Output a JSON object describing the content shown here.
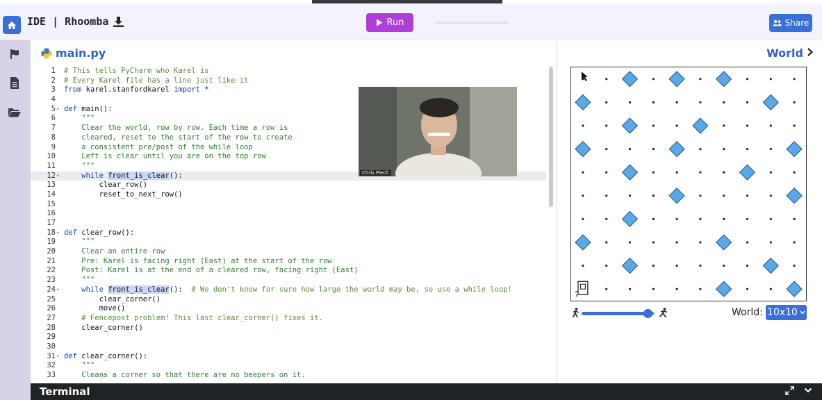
{
  "topbar": {
    "app_title": "IDE | Rhoomba",
    "run_label": "Run",
    "share_label": "Share"
  },
  "editor": {
    "file_name": "main.py",
    "lines": [
      {
        "n": "1",
        "fold": "",
        "active": false,
        "parts": [
          {
            "c": "cm",
            "t": "# This tells PyCharm who Karel is"
          }
        ]
      },
      {
        "n": "2",
        "fold": "",
        "active": false,
        "parts": [
          {
            "c": "cm",
            "t": "# Every Karel file has a line just like it"
          }
        ]
      },
      {
        "n": "3",
        "fold": "",
        "active": false,
        "parts": [
          {
            "c": "kw",
            "t": "from"
          },
          {
            "c": "fn",
            "t": " karel.stanfordkarel "
          },
          {
            "c": "kw",
            "t": "import"
          },
          {
            "c": "fn",
            "t": " *"
          }
        ]
      },
      {
        "n": "4",
        "fold": "",
        "active": false,
        "parts": []
      },
      {
        "n": "5",
        "fold": "▾",
        "active": false,
        "parts": [
          {
            "c": "kw",
            "t": "def"
          },
          {
            "c": "fn",
            "t": " main():"
          }
        ]
      },
      {
        "n": "6",
        "fold": "",
        "active": false,
        "parts": [
          {
            "c": "st",
            "t": "    \"\"\""
          }
        ]
      },
      {
        "n": "7",
        "fold": "",
        "active": false,
        "parts": [
          {
            "c": "st",
            "t": "    Clear the world, row by row. Each time a row is"
          }
        ]
      },
      {
        "n": "8",
        "fold": "",
        "active": false,
        "parts": [
          {
            "c": "st",
            "t": "    cleared, reset to the start of the row to create"
          }
        ]
      },
      {
        "n": "9",
        "fold": "",
        "active": false,
        "parts": [
          {
            "c": "st",
            "t": "    a consistent pre/post of the while loop"
          }
        ]
      },
      {
        "n": "10",
        "fold": "",
        "active": false,
        "parts": [
          {
            "c": "st",
            "t": "    Left is clear until you are on the top row"
          }
        ]
      },
      {
        "n": "11",
        "fold": "",
        "active": false,
        "parts": [
          {
            "c": "st",
            "t": "    \"\"\""
          }
        ]
      },
      {
        "n": "12",
        "fold": "▾",
        "active": true,
        "parts": [
          {
            "c": "kw",
            "t": "    while"
          },
          {
            "c": "fn",
            "t": " "
          },
          {
            "c": "fn hl",
            "t": "front_is_clear"
          },
          {
            "c": "fn",
            "t": "():"
          }
        ]
      },
      {
        "n": "13",
        "fold": "",
        "active": false,
        "parts": [
          {
            "c": "fn",
            "t": "        clear_row()"
          }
        ]
      },
      {
        "n": "14",
        "fold": "",
        "active": false,
        "parts": [
          {
            "c": "fn",
            "t": "        reset_to_next_row()"
          }
        ]
      },
      {
        "n": "15",
        "fold": "",
        "active": false,
        "parts": []
      },
      {
        "n": "16",
        "fold": "",
        "active": false,
        "parts": []
      },
      {
        "n": "17",
        "fold": "",
        "active": false,
        "parts": []
      },
      {
        "n": "18",
        "fold": "▾",
        "active": false,
        "parts": [
          {
            "c": "kw",
            "t": "def"
          },
          {
            "c": "fn",
            "t": " clear_row():"
          }
        ]
      },
      {
        "n": "19",
        "fold": "",
        "active": false,
        "parts": [
          {
            "c": "st",
            "t": "    \"\"\""
          }
        ]
      },
      {
        "n": "20",
        "fold": "",
        "active": false,
        "parts": [
          {
            "c": "st",
            "t": "    Clear an entire row"
          }
        ]
      },
      {
        "n": "21",
        "fold": "",
        "active": false,
        "parts": [
          {
            "c": "st",
            "t": "    Pre: Karel is facing right (East) at the start of the row"
          }
        ]
      },
      {
        "n": "22",
        "fold": "",
        "active": false,
        "parts": [
          {
            "c": "st",
            "t": "    Post: Karel is at the end of a cleared row, facing right (East)"
          }
        ]
      },
      {
        "n": "23",
        "fold": "",
        "active": false,
        "parts": [
          {
            "c": "st",
            "t": "    \"\"\""
          }
        ]
      },
      {
        "n": "24",
        "fold": "▾",
        "active": false,
        "parts": [
          {
            "c": "kw",
            "t": "    while"
          },
          {
            "c": "fn",
            "t": " "
          },
          {
            "c": "fn hl",
            "t": "front_is_clear"
          },
          {
            "c": "fn",
            "t": "():  "
          },
          {
            "c": "cm",
            "t": "# We don't know for sure how large the world may be, so use a while loop!"
          }
        ]
      },
      {
        "n": "25",
        "fold": "",
        "active": false,
        "parts": [
          {
            "c": "fn",
            "t": "        clear_corner()"
          }
        ]
      },
      {
        "n": "26",
        "fold": "",
        "active": false,
        "parts": [
          {
            "c": "fn",
            "t": "        move()"
          }
        ]
      },
      {
        "n": "27",
        "fold": "",
        "active": false,
        "parts": [
          {
            "c": "cm",
            "t": "    # Fencepost problem! This last clear_corner() fixes it."
          }
        ]
      },
      {
        "n": "28",
        "fold": "",
        "active": false,
        "parts": [
          {
            "c": "fn",
            "t": "    clear_corner()"
          }
        ]
      },
      {
        "n": "29",
        "fold": "",
        "active": false,
        "parts": []
      },
      {
        "n": "30",
        "fold": "",
        "active": false,
        "parts": []
      },
      {
        "n": "31",
        "fold": "▾",
        "active": false,
        "parts": [
          {
            "c": "kw",
            "t": "def"
          },
          {
            "c": "fn",
            "t": " clear_corner():"
          }
        ]
      },
      {
        "n": "32",
        "fold": "",
        "active": false,
        "parts": [
          {
            "c": "st",
            "t": "    \"\"\""
          }
        ]
      },
      {
        "n": "33",
        "fold": "",
        "active": false,
        "parts": [
          {
            "c": "st",
            "t": "    Cleans a corner so that there are no beepers on it."
          }
        ]
      }
    ]
  },
  "video": {
    "speaker_name": "Chris Piech"
  },
  "world": {
    "title": "World",
    "size_label": "World:",
    "size_value": "10x10",
    "rows": 10,
    "cols": 10,
    "beepers": [
      [
        0,
        2
      ],
      [
        0,
        4
      ],
      [
        0,
        6
      ],
      [
        1,
        0
      ],
      [
        1,
        8
      ],
      [
        2,
        2
      ],
      [
        2,
        5
      ],
      [
        3,
        0
      ],
      [
        3,
        4
      ],
      [
        3,
        9
      ],
      [
        4,
        2
      ],
      [
        4,
        7
      ],
      [
        5,
        4
      ],
      [
        5,
        9
      ],
      [
        6,
        2
      ],
      [
        7,
        0
      ],
      [
        7,
        6
      ],
      [
        8,
        2
      ],
      [
        8,
        8
      ],
      [
        9,
        6
      ],
      [
        9,
        9
      ]
    ],
    "karel": [
      9,
      0
    ],
    "speed_fraction": 0.92,
    "beeper_color": "#5aa9e6"
  },
  "terminal": {
    "label": "Terminal"
  },
  "colors": {
    "accent": "#3a6fd8",
    "run": "#b03ed8"
  }
}
